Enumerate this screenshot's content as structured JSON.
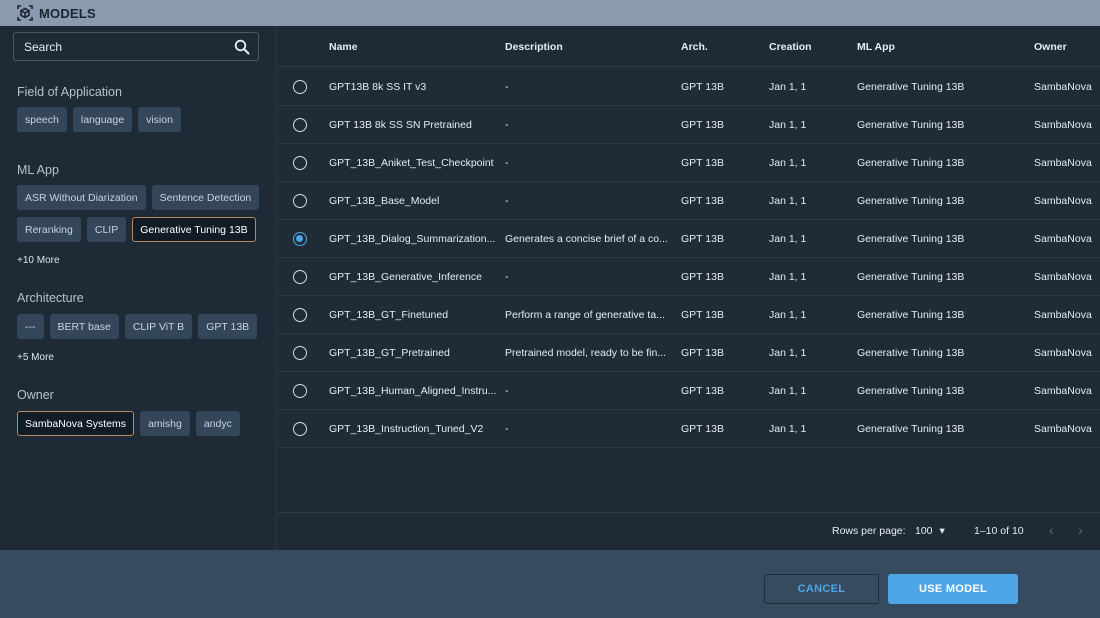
{
  "window": {
    "title": "MODELS",
    "icon": "models-cube-icon"
  },
  "sidebar": {
    "search": {
      "placeholder": "Search",
      "value": ""
    },
    "sections": [
      {
        "label": "Field of Application",
        "chips": [
          {
            "label": "speech",
            "selected": false
          },
          {
            "label": "language",
            "selected": false
          },
          {
            "label": "vision",
            "selected": false
          }
        ]
      },
      {
        "label": "ML App",
        "chips_row1": [
          {
            "label": "ASR Without Diarization",
            "selected": false
          },
          {
            "label": "Sentence Detection",
            "selected": false
          }
        ],
        "chips_row2": [
          {
            "label": "Reranking",
            "selected": false
          },
          {
            "label": "CLIP",
            "selected": false
          },
          {
            "label": "Generative Tuning 13B",
            "selected": true
          }
        ],
        "more": "+10 More"
      },
      {
        "label": "Architecture",
        "chips": [
          {
            "label": "---",
            "selected": false
          },
          {
            "label": "BERT base",
            "selected": false
          },
          {
            "label": "CLIP ViT B",
            "selected": false
          },
          {
            "label": "GPT 13B",
            "selected": false
          }
        ],
        "more": "+5 More"
      },
      {
        "label": "Owner",
        "chips": [
          {
            "label": "SambaNova Systems",
            "selected": true
          },
          {
            "label": "amishg",
            "selected": false
          },
          {
            "label": "andyc",
            "selected": false
          }
        ]
      }
    ]
  },
  "table": {
    "columns": [
      "Name",
      "Description",
      "Arch.",
      "Creation",
      "ML App",
      "Owner"
    ],
    "rows": [
      {
        "selected": false,
        "name": "GPT13B 8k SS IT v3",
        "description": "-",
        "arch": "GPT 13B",
        "creation": "Jan 1, 1",
        "ml_app": "Generative Tuning 13B",
        "owner": "SambaNova"
      },
      {
        "selected": false,
        "name": "GPT 13B 8k SS SN Pretrained",
        "description": "-",
        "arch": "GPT 13B",
        "creation": "Jan 1, 1",
        "ml_app": "Generative Tuning 13B",
        "owner": "SambaNova"
      },
      {
        "selected": false,
        "name": "GPT_13B_Aniket_Test_Checkpoint",
        "description": "-",
        "arch": "GPT 13B",
        "creation": "Jan 1, 1",
        "ml_app": "Generative Tuning 13B",
        "owner": "SambaNova"
      },
      {
        "selected": false,
        "name": "GPT_13B_Base_Model",
        "description": "-",
        "arch": "GPT 13B",
        "creation": "Jan 1, 1",
        "ml_app": "Generative Tuning 13B",
        "owner": "SambaNova"
      },
      {
        "selected": true,
        "name": "GPT_13B_Dialog_Summarization...",
        "description": "Generates a concise brief of a co...",
        "arch": "GPT 13B",
        "creation": "Jan 1, 1",
        "ml_app": "Generative Tuning 13B",
        "owner": "SambaNova"
      },
      {
        "selected": false,
        "name": "GPT_13B_Generative_Inference",
        "description": "-",
        "arch": "GPT 13B",
        "creation": "Jan 1, 1",
        "ml_app": "Generative Tuning 13B",
        "owner": "SambaNova"
      },
      {
        "selected": false,
        "name": "GPT_13B_GT_Finetuned",
        "description": "Perform a range of generative ta...",
        "arch": "GPT 13B",
        "creation": "Jan 1, 1",
        "ml_app": "Generative Tuning 13B",
        "owner": "SambaNova"
      },
      {
        "selected": false,
        "name": "GPT_13B_GT_Pretrained",
        "description": "Pretrained model, ready to be fin...",
        "arch": "GPT 13B",
        "creation": "Jan 1, 1",
        "ml_app": "Generative Tuning 13B",
        "owner": "SambaNova"
      },
      {
        "selected": false,
        "name": "GPT_13B_Human_Aligned_Instru...",
        "description": "-",
        "arch": "GPT 13B",
        "creation": "Jan 1, 1",
        "ml_app": "Generative Tuning 13B",
        "owner": "SambaNova"
      },
      {
        "selected": false,
        "name": "GPT_13B_Instruction_Tuned_V2",
        "description": "-",
        "arch": "GPT 13B",
        "creation": "Jan 1, 1",
        "ml_app": "Generative Tuning 13B",
        "owner": "SambaNova"
      }
    ]
  },
  "pagination": {
    "rows_per_page_label": "Rows per page:",
    "rows_per_page": "100",
    "range": "1–10 of 10",
    "prev": "‹",
    "next": "›",
    "dropdown_caret": "▾"
  },
  "actions": {
    "cancel": "CANCEL",
    "use_model": "USE MODEL"
  },
  "colors": {
    "accent": "#4ea6e6",
    "selected_chip_border": "#b48a64",
    "titlebar": "#8a9bb0",
    "actionbar": "#364b60"
  }
}
